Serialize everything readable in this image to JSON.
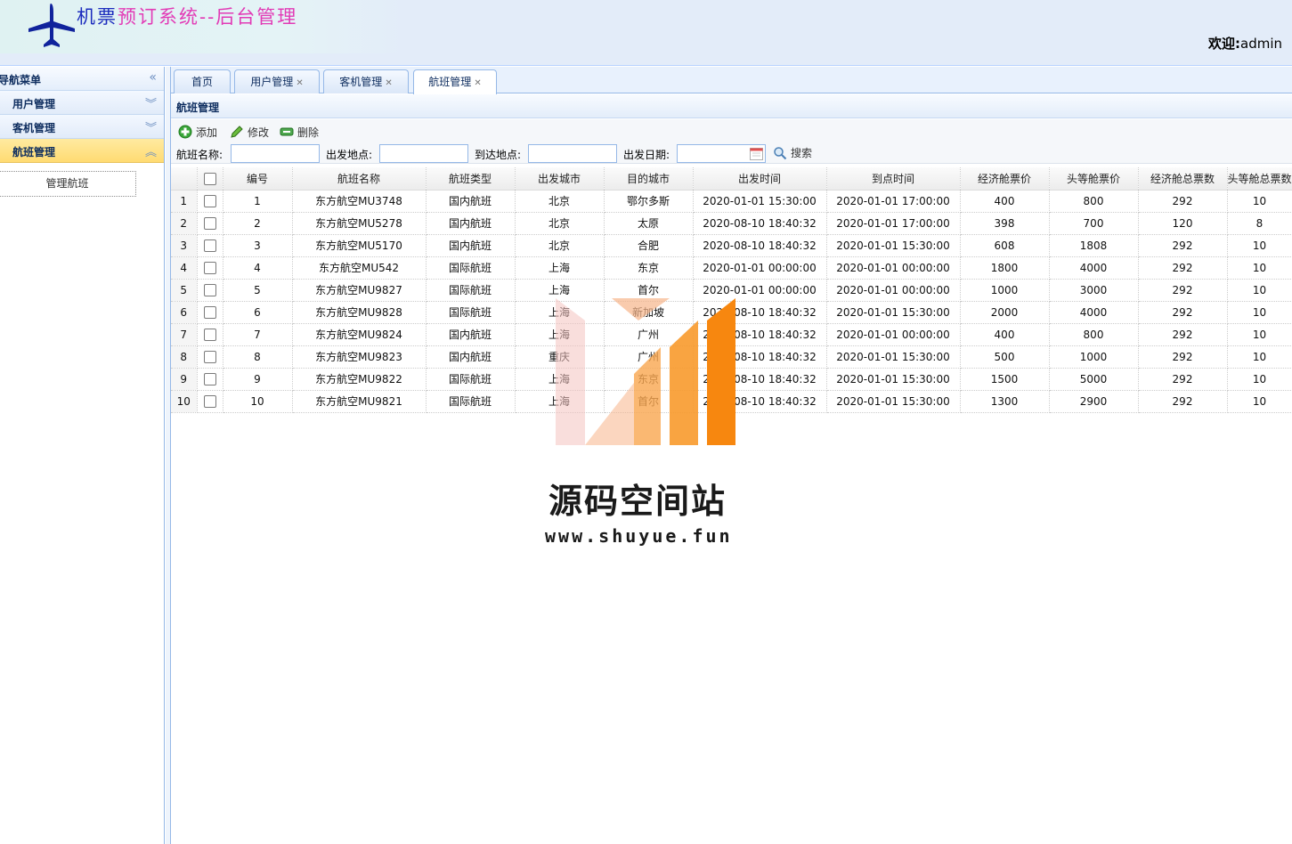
{
  "header": {
    "title_part1": "机票",
    "title_part2": "预订",
    "title_part3": "系统",
    "title_part4": "--后台管理",
    "welcome_label": "欢迎:",
    "username": "admin"
  },
  "sidebar": {
    "title": "导航菜单",
    "items": [
      {
        "label": "用户管理"
      },
      {
        "label": "客机管理"
      },
      {
        "label": "航班管理"
      }
    ],
    "sub_button": "管理航班"
  },
  "tabs": [
    {
      "label": "首页"
    },
    {
      "label": "用户管理"
    },
    {
      "label": "客机管理"
    },
    {
      "label": "航班管理"
    }
  ],
  "panel": {
    "title": "航班管理"
  },
  "toolbar": {
    "add_label": "添加",
    "edit_label": "修改",
    "delete_label": "删除",
    "search_label": "搜索"
  },
  "search": {
    "flight_name_label": "航班名称:",
    "depart_place_label": "出发地点:",
    "arrive_place_label": "到达地点:",
    "depart_date_label": "出发日期:"
  },
  "table": {
    "columns": [
      "编号",
      "航班名称",
      "航班类型",
      "出发城市",
      "目的城市",
      "出发时间",
      "到点时间",
      "经济舱票价",
      "头等舱票价",
      "经济舱总票数",
      "头等舱总票数"
    ],
    "rows": [
      [
        "1",
        "1",
        "东方航空MU3748",
        "国内航班",
        "北京",
        "鄂尔多斯",
        "2020-01-01 15:30:00",
        "2020-01-01 17:00:00",
        "400",
        "800",
        "292",
        "10"
      ],
      [
        "2",
        "2",
        "东方航空MU5278",
        "国内航班",
        "北京",
        "太原",
        "2020-08-10 18:40:32",
        "2020-01-01 17:00:00",
        "398",
        "700",
        "120",
        "8"
      ],
      [
        "3",
        "3",
        "东方航空MU5170",
        "国内航班",
        "北京",
        "合肥",
        "2020-08-10 18:40:32",
        "2020-01-01 15:30:00",
        "608",
        "1808",
        "292",
        "10"
      ],
      [
        "4",
        "4",
        "东方航空MU542",
        "国际航班",
        "上海",
        "东京",
        "2020-01-01 00:00:00",
        "2020-01-01 00:00:00",
        "1800",
        "4000",
        "292",
        "10"
      ],
      [
        "5",
        "5",
        "东方航空MU9827",
        "国际航班",
        "上海",
        "首尔",
        "2020-01-01 00:00:00",
        "2020-01-01 00:00:00",
        "1000",
        "3000",
        "292",
        "10"
      ],
      [
        "6",
        "6",
        "东方航空MU9828",
        "国际航班",
        "上海",
        "新加坡",
        "2020-08-10 18:40:32",
        "2020-01-01 15:30:00",
        "2000",
        "4000",
        "292",
        "10"
      ],
      [
        "7",
        "7",
        "东方航空MU9824",
        "国内航班",
        "上海",
        "广州",
        "2020-08-10 18:40:32",
        "2020-01-01 00:00:00",
        "400",
        "800",
        "292",
        "10"
      ],
      [
        "8",
        "8",
        "东方航空MU9823",
        "国内航班",
        "重庆",
        "广州",
        "2020-08-10 18:40:32",
        "2020-01-01 15:30:00",
        "500",
        "1000",
        "292",
        "10"
      ],
      [
        "9",
        "9",
        "东方航空MU9822",
        "国际航班",
        "上海",
        "东京",
        "2020-08-10 18:40:32",
        "2020-01-01 15:30:00",
        "1500",
        "5000",
        "292",
        "10"
      ],
      [
        "10",
        "10",
        "东方航空MU9821",
        "国际航班",
        "上海",
        "首尔",
        "2020-08-10 18:40:32",
        "2020-01-01 15:30:00",
        "1300",
        "2900",
        "292",
        "10"
      ]
    ]
  },
  "watermark": {
    "title": "源码空间站",
    "url": "www.shuyue.fun"
  },
  "colors": {
    "accent_blue": "#95b8e7",
    "active_accordion": "#ffdb72",
    "watermark_orange": "#f7931e"
  }
}
